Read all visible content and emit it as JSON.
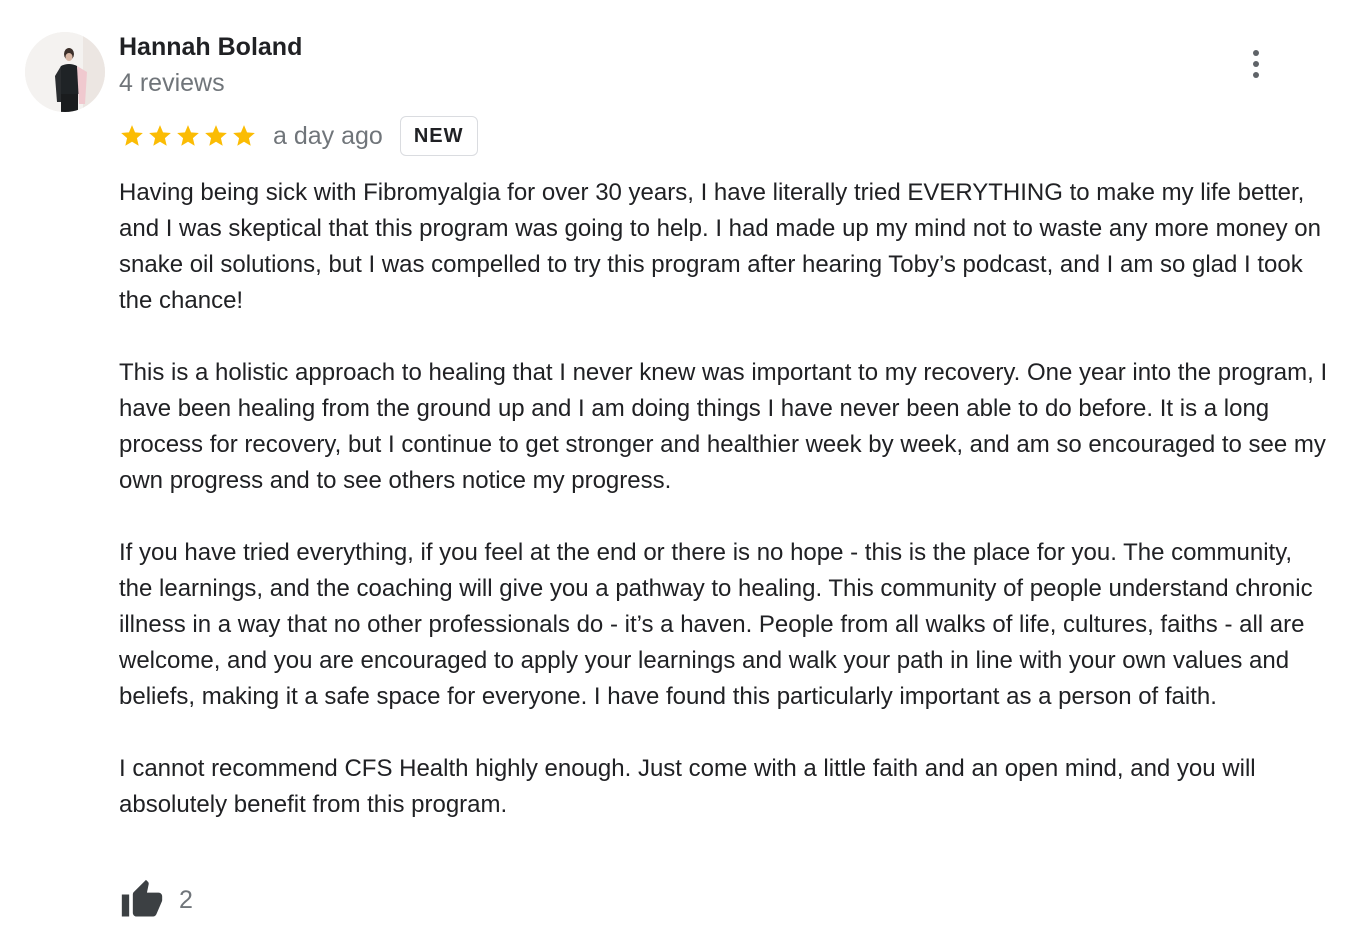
{
  "review": {
    "author_name": "Hannah Boland",
    "review_count": "4 reviews",
    "rating": 5,
    "rating_max": 5,
    "timestamp": "a day ago",
    "badge": "NEW",
    "paragraphs": [
      "Having being sick with Fibromyalgia for over 30 years, I have literally tried EVERYTHING to make my life better, and I was skeptical that this program was going to help. I had made up my mind not to waste any more money on snake oil solutions, but I was compelled to try this program after hearing Toby’s podcast, and I am so glad I took the chance!",
      "This is a holistic approach to healing that I never knew was important to my recovery. One year into the program, I have been healing from the ground up and I am doing things I have never been able to do before. It is a long process for recovery, but I continue to get stronger and healthier week by week, and am so encouraged to see my own progress and to see others notice my progress.",
      "If you have tried everything, if you feel at the end or there is no hope - this is the place for you. The community, the learnings, and the coaching will give you a pathway to healing. This community of people understand chronic illness in a way that no other professionals do - it’s a haven. People from all walks of life, cultures, faiths - all are welcome, and you are encouraged to apply your learnings and walk your path in line with your own values and beliefs, making it a safe space for everyone. I have found this particularly important as a person of faith.",
      "I cannot recommend CFS Health highly enough. Just come with a little faith and an open mind, and you will absolutely benefit from this program."
    ],
    "like_count": "2"
  },
  "icons": {
    "star": "star-icon",
    "more": "more-vert-icon",
    "like": "thumbs-up-icon"
  },
  "colors": {
    "star": "#fbbc04",
    "text": "#202124",
    "secondary_text": "#70757a",
    "icon_gray": "#5f6368",
    "thumb": "#3c4043"
  }
}
